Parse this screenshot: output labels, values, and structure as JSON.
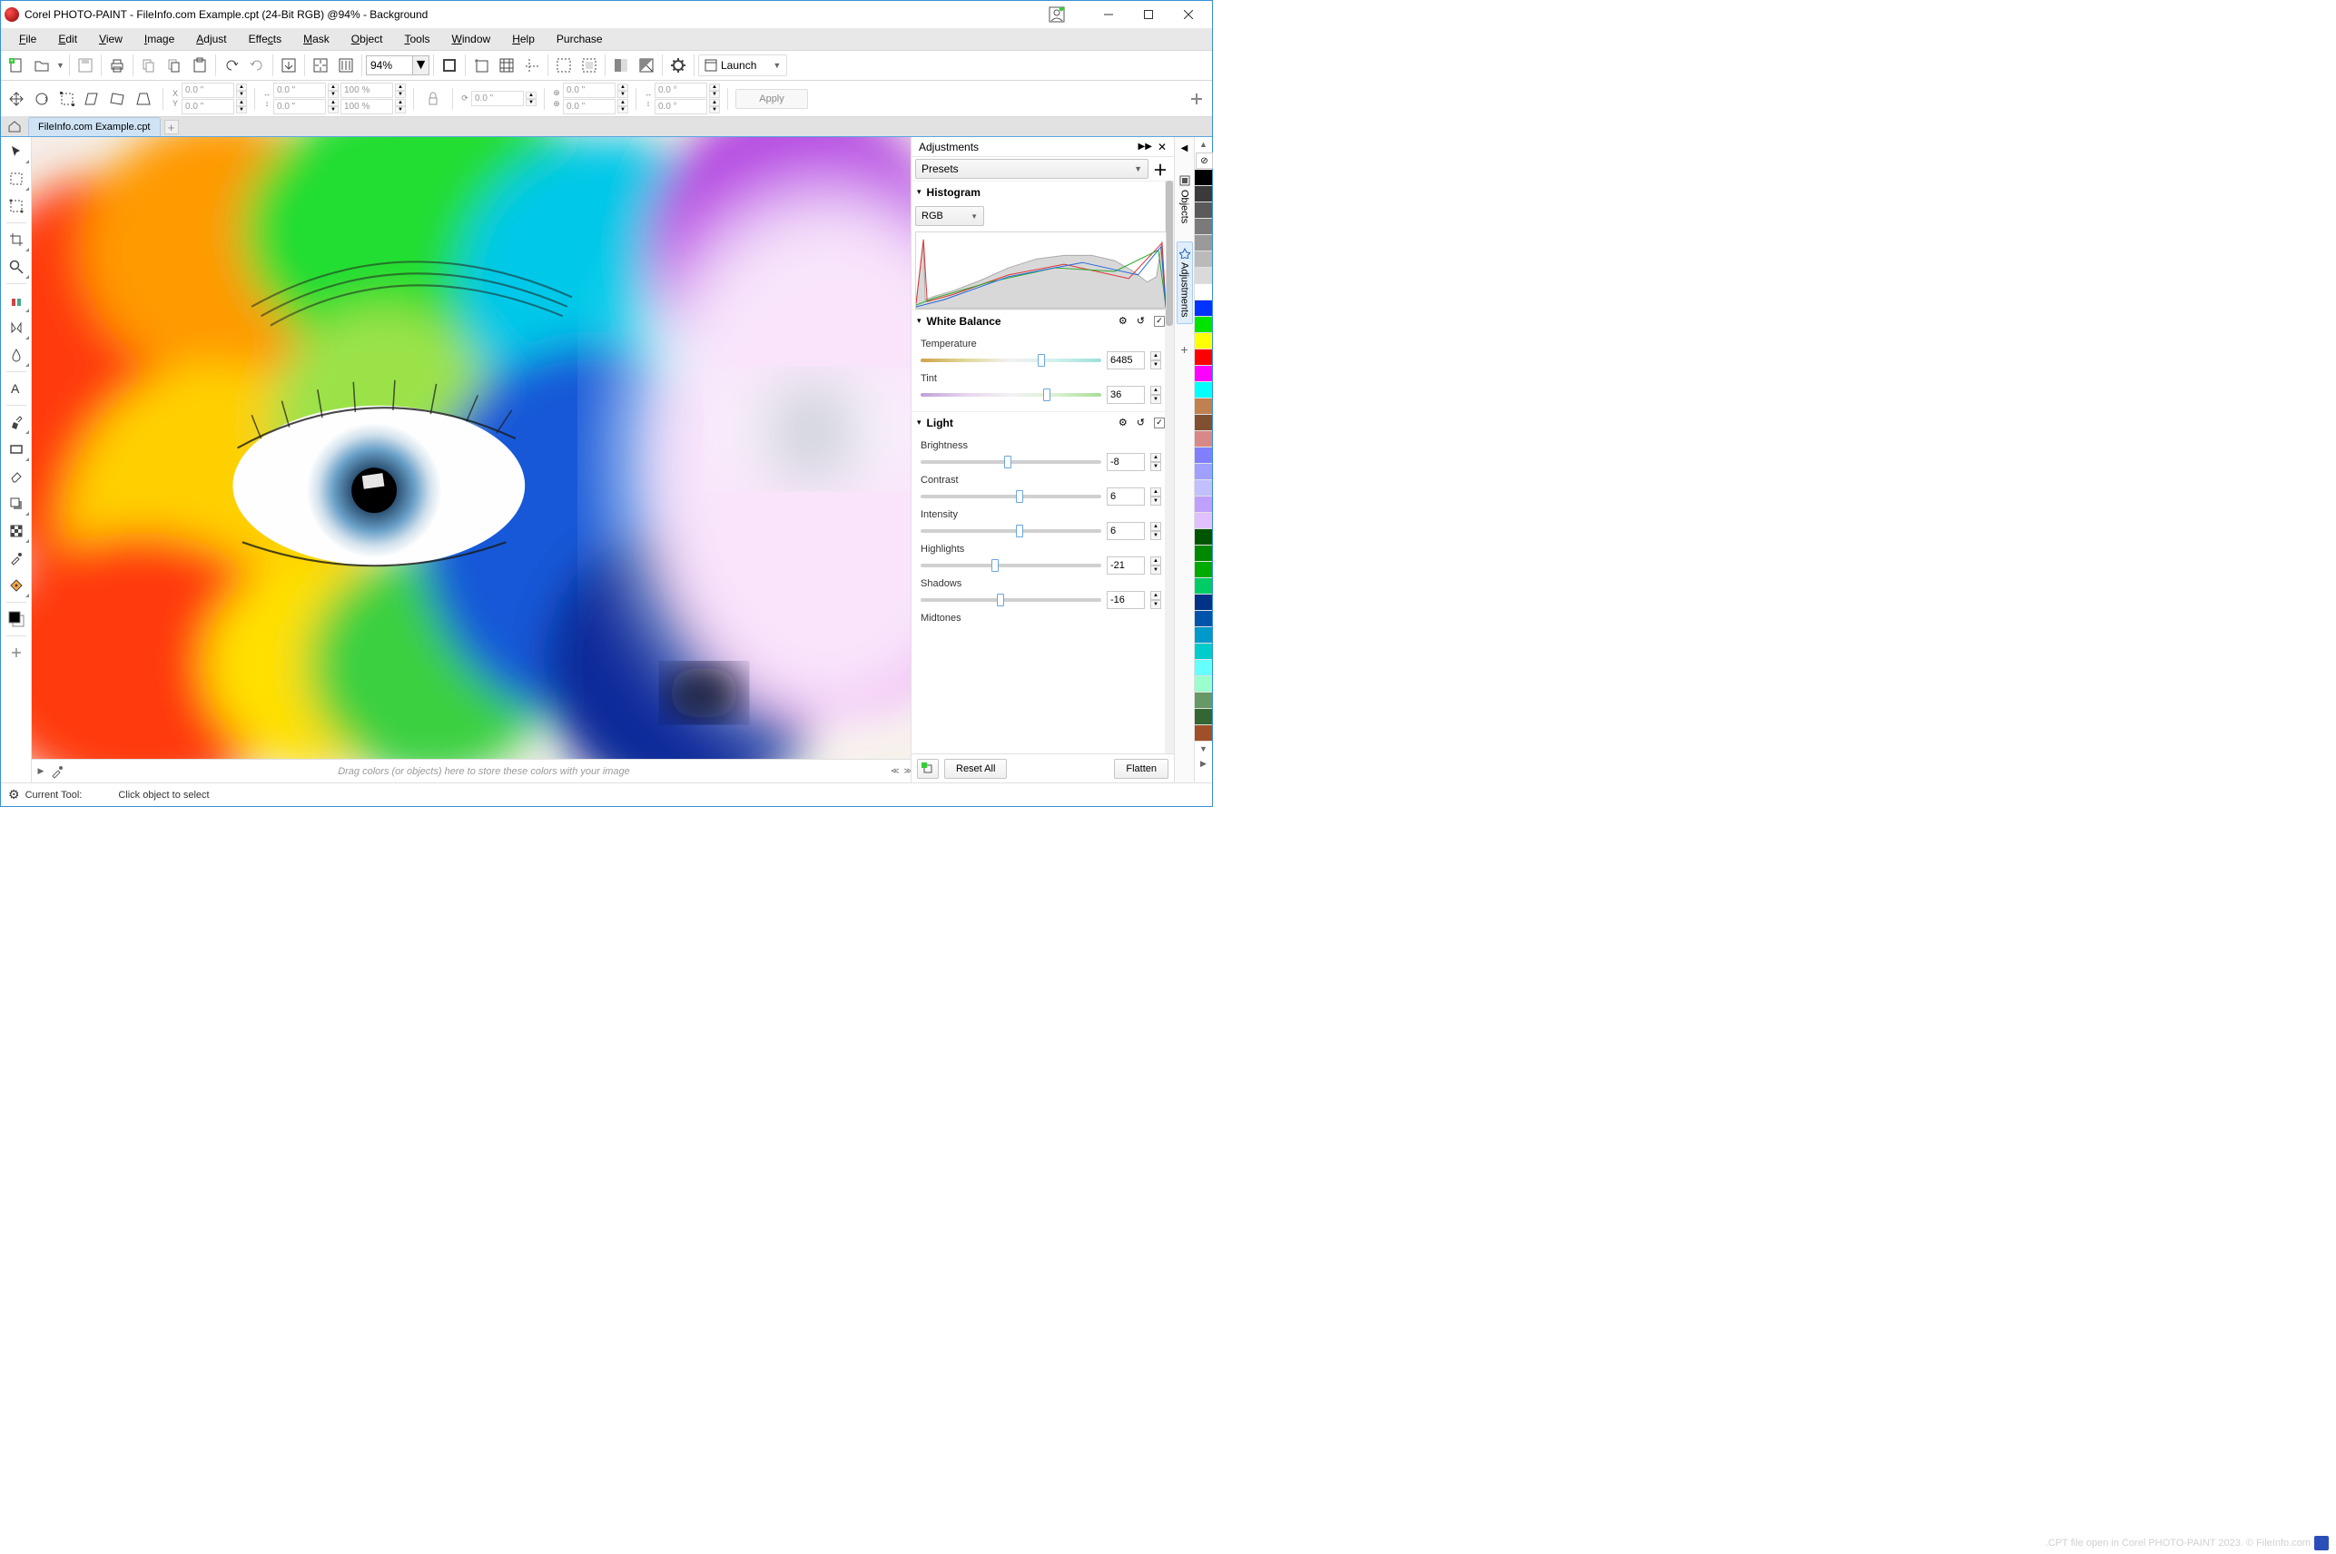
{
  "title": "Corel PHOTO-PAINT - FileInfo.com Example.cpt (24-Bit RGB) @94% - Background",
  "menu": [
    "File",
    "Edit",
    "View",
    "Image",
    "Adjust",
    "Effects",
    "Mask",
    "Object",
    "Tools",
    "Window",
    "Help",
    "Purchase"
  ],
  "menu_hotkeys": [
    "F",
    "E",
    "V",
    "I",
    "A",
    "c",
    "M",
    "O",
    "T",
    "W",
    "H",
    "P"
  ],
  "toolbar": {
    "zoom": "94%",
    "launch_label": "Launch"
  },
  "propbar": {
    "x": "0.0 \"",
    "y": "0.0 \"",
    "w": "0.0 \"",
    "h": "0.0 \"",
    "sx": "100 %",
    "sy": "100 %",
    "ax": "0.0 \"",
    "ay": "0.0 \"",
    "r1": "0.0 \"",
    "r2": "0.0 \"",
    "a1": "0.0 °",
    "a2": "0.0 °",
    "apply": "Apply"
  },
  "tabs": {
    "doc": "FileInfo.com Example.cpt"
  },
  "colorbar_msg": "Drag colors (or objects) here to store these colors with your image",
  "adjustments": {
    "title": "Adjustments",
    "presets": "Presets",
    "histogram": {
      "title": "Histogram",
      "channel": "RGB"
    },
    "white_balance": {
      "title": "White Balance",
      "temperature_label": "Temperature",
      "temperature": "6485",
      "tint_label": "Tint",
      "tint": "36"
    },
    "light": {
      "title": "Light",
      "brightness_label": "Brightness",
      "brightness": "-8",
      "contrast_label": "Contrast",
      "contrast": "6",
      "intensity_label": "Intensity",
      "intensity": "6",
      "highlights_label": "Highlights",
      "highlights": "-21",
      "shadows_label": "Shadows",
      "shadows": "-16",
      "midtones_label": "Midtones"
    },
    "reset_all": "Reset All",
    "flatten": "Flatten"
  },
  "dockers": {
    "objects": "Objects",
    "adjustments": "Adjustments"
  },
  "palette": [
    "#000000",
    "#3a3a3a",
    "#5a5a5a",
    "#7a7a7a",
    "#9a9a9a",
    "#bababa",
    "#dadada",
    "#ffffff",
    "#0033ff",
    "#00e500",
    "#ffff00",
    "#ff0000",
    "#ff00ff",
    "#00ffff",
    "#c08050",
    "#805030",
    "#d88888",
    "#8080ff",
    "#a0a0ff",
    "#c0c0ff",
    "#c0a0ff",
    "#e0c0ff",
    "#005500",
    "#008800",
    "#00aa00",
    "#00cc66",
    "#003388",
    "#0055aa",
    "#0099cc",
    "#00cccc",
    "#66ffff",
    "#99ffcc",
    "#669966",
    "#336633",
    "#a05028"
  ],
  "status": {
    "current_tool_label": "Current Tool:",
    "hint": "Click object to select"
  },
  "credit": ".CPT file open in Corel PHOTO-PAINT 2023. © FileInfo.com"
}
